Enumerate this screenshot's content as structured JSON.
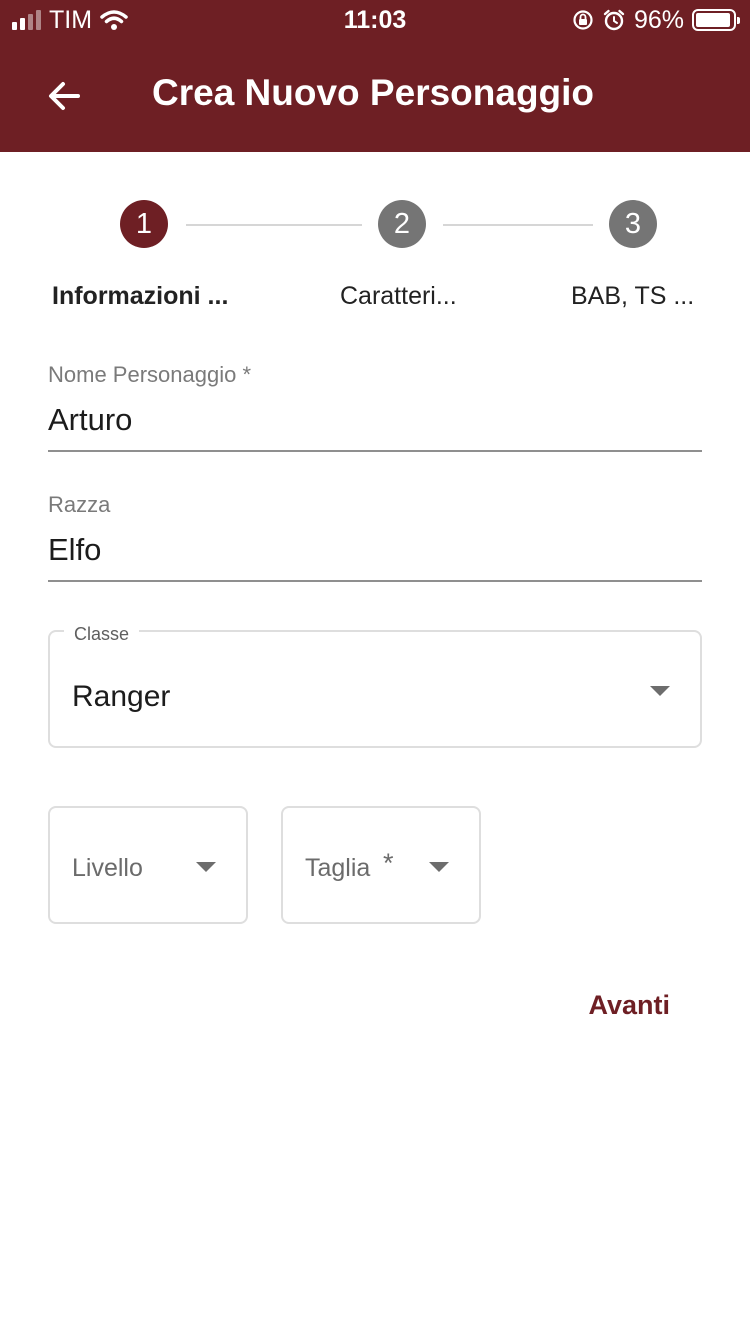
{
  "status_bar": {
    "carrier": "TIM",
    "time": "11:03",
    "battery_percent": "96%",
    "icons": [
      "signal-icon",
      "wifi-icon",
      "rotation-lock-icon",
      "alarm-icon",
      "battery-icon"
    ]
  },
  "app_bar": {
    "title": "Crea Nuovo Personaggio",
    "back_icon": "arrow-left-icon"
  },
  "stepper": {
    "steps": [
      {
        "number": "1",
        "label": "Informazioni ...",
        "active": true
      },
      {
        "number": "2",
        "label": "Caratteri...",
        "active": false
      },
      {
        "number": "3",
        "label": "BAB, TS ...",
        "active": false
      }
    ]
  },
  "form": {
    "nome": {
      "label": "Nome Personaggio *",
      "value": "Arturo"
    },
    "razza": {
      "label": "Razza",
      "value": "Elfo"
    },
    "classe": {
      "label": "Classe",
      "value": "Ranger"
    },
    "livello": {
      "placeholder": "Livello"
    },
    "taglia": {
      "placeholder": "Taglia",
      "required_mark": "*"
    }
  },
  "actions": {
    "next_label": "Avanti"
  },
  "colors": {
    "primary": "#6e1f24",
    "step_inactive": "#757575",
    "background": "#ffffff"
  }
}
